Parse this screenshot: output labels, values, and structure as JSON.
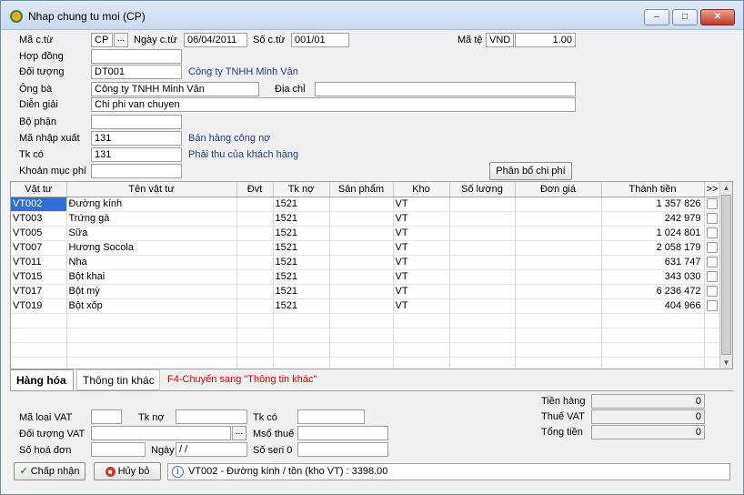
{
  "window": {
    "title": "Nhap chung tu moi (CP)",
    "minimize_glyph": "–",
    "maximize_glyph": "□",
    "close_glyph": "✕"
  },
  "header": {
    "ma_ctu_label": "Mã c.từ",
    "ma_ctu_value": "CP",
    "browse_glyph": "...",
    "ngay_ctu_label": "Ngày c.từ",
    "ngay_ctu_value": "06/04/2011",
    "so_ctu_label": "Số c.từ",
    "so_ctu_value": "001/01",
    "ma_te_label": "Mã tệ",
    "ma_te_value": "VND",
    "ty_gia_value": "1.00",
    "hop_dong_label": "Hợp đồng",
    "hop_dong_value": "",
    "doi_tuong_label": "Đối tượng",
    "doi_tuong_value": "DT001",
    "doi_tuong_name": "Công ty TNHH Minh Vân",
    "ong_ba_label": "Ông bà",
    "ong_ba_value": "Công ty TNHH Minh Vân",
    "dia_chi_label": "Địa chỉ",
    "dia_chi_value": "",
    "dien_giai_label": "Diễn giải",
    "dien_giai_value": "Chi phi van chuyen",
    "bo_phan_label": "Bộ phận",
    "bo_phan_value": "",
    "ma_nx_label": "Mã nhập xuất",
    "ma_nx_value": "131",
    "ma_nx_name": "Bán hàng công nợ",
    "tk_co_label": "Tk có",
    "tk_co_value": "131",
    "tk_co_name": "Phải thu của khách hàng",
    "khoan_muc_label": "Khoản mục phí",
    "khoan_muc_value": "",
    "phan_bo_button": "Phân bổ chi phí"
  },
  "grid": {
    "columns": [
      "Vật tư",
      "Tên vật tư",
      "Đvt",
      "Tk nợ",
      "Sản phẩm",
      "Kho",
      "Số lượng",
      "Đơn giá",
      "Thành tiền",
      ">>"
    ],
    "rows": [
      {
        "code": "VT002",
        "name": "Đường kính",
        "dvt": "",
        "tkno": "1521",
        "sp": "",
        "kho": "VT",
        "sl": "",
        "dg": "",
        "tt": "1 357 826"
      },
      {
        "code": "VT003",
        "name": "Trứng gà",
        "dvt": "",
        "tkno": "1521",
        "sp": "",
        "kho": "VT",
        "sl": "",
        "dg": "",
        "tt": "242 979"
      },
      {
        "code": "VT005",
        "name": "Sữa",
        "dvt": "",
        "tkno": "1521",
        "sp": "",
        "kho": "VT",
        "sl": "",
        "dg": "",
        "tt": "1 024 801"
      },
      {
        "code": "VT007",
        "name": "Hương Socola",
        "dvt": "",
        "tkno": "1521",
        "sp": "",
        "kho": "VT",
        "sl": "",
        "dg": "",
        "tt": "2 058 179"
      },
      {
        "code": "VT011",
        "name": "Nha",
        "dvt": "",
        "tkno": "1521",
        "sp": "",
        "kho": "VT",
        "sl": "",
        "dg": "",
        "tt": "631 747"
      },
      {
        "code": "VT015",
        "name": "Bột khai",
        "dvt": "",
        "tkno": "1521",
        "sp": "",
        "kho": "VT",
        "sl": "",
        "dg": "",
        "tt": "343 030"
      },
      {
        "code": "VT017",
        "name": "Bột mỳ",
        "dvt": "",
        "tkno": "1521",
        "sp": "",
        "kho": "VT",
        "sl": "",
        "dg": "",
        "tt": "6 236 472"
      },
      {
        "code": "VT019",
        "name": "Bột xốp",
        "dvt": "",
        "tkno": "1521",
        "sp": "",
        "kho": "VT",
        "sl": "",
        "dg": "",
        "tt": "404 966"
      }
    ],
    "empty_rows": 4
  },
  "tabs": {
    "hang_hoa": "Hàng hóa",
    "thong_tin_khac": "Thông tin khác",
    "hint": "F4-Chuyển sang \"Thông tin khác\""
  },
  "vat": {
    "ma_loai_label": "Mã loại VAT",
    "ma_loai_value": "",
    "tk_no_label": "Tk nợ",
    "tk_no_value": "",
    "tk_co_label": "Tk có",
    "tk_co_value": "",
    "doi_tuong_label": "Đối tượng VAT",
    "doi_tuong_value": "",
    "mso_thue_label": "Msố thuế",
    "mso_thue_value": "",
    "so_hd_label": "Số hoá đơn",
    "so_hd_value": "",
    "ngay_label": "Ngày",
    "ngay_value": " /  /",
    "so_seri_label": "Số seri 0",
    "so_seri_value": ""
  },
  "totals": {
    "tien_hang_label": "Tiền hàng",
    "tien_hang_value": "0",
    "thue_vat_label": "Thuế VAT",
    "thue_vat_value": "0",
    "tong_tien_label": "Tổng tiền",
    "tong_tien_value": "0"
  },
  "footer": {
    "accept_button": "Chấp nhận",
    "cancel_button": "Hủy bỏ",
    "status_text": "VT002 - Đường kính / tồn (kho VT) : 3398.00"
  },
  "colors": {
    "link": "#1e3d8f",
    "hint": "#e00000",
    "selection": "#2f6fd6",
    "accept_icon": "#2e9a3e",
    "cancel_icon": "#c0392b"
  },
  "icons": [
    "app-icon",
    "browse-icon",
    "check-icon",
    "cancel-icon",
    "info-icon",
    "scroll-up-icon",
    "scroll-down-icon"
  ]
}
